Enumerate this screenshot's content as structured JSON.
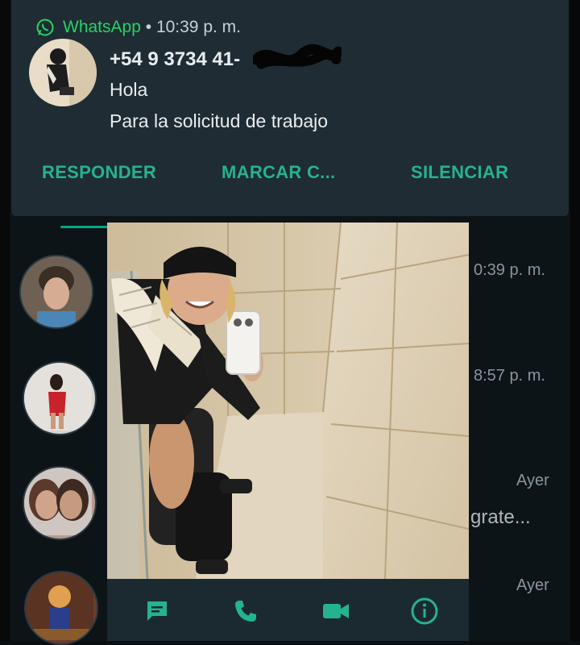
{
  "notification": {
    "app_name": "WhatsApp",
    "separator": "•",
    "time": "10:39 p. m.",
    "sender_number": "+54 9 3734 41-",
    "messages": [
      "Hola",
      "Para la solicitud de trabajo"
    ],
    "actions": [
      "RESPONDER",
      "MARCAR C...",
      "SILENCIAR"
    ]
  },
  "chat_list": {
    "times": [
      "0:39 p. m.",
      "8:57 p. m.",
      "Ayer",
      "Ayer"
    ],
    "snippet": "grate..."
  },
  "profile_popup": {
    "actions": [
      {
        "icon": "message-icon",
        "label": "message"
      },
      {
        "icon": "phone-icon",
        "label": "call"
      },
      {
        "icon": "video-icon",
        "label": "video"
      },
      {
        "icon": "info-icon",
        "label": "info"
      }
    ]
  },
  "colors": {
    "accent": "#25b38e",
    "whatsapp_green": "#25d366",
    "card_bg": "#1f2c33",
    "list_bg": "#0d1418"
  }
}
